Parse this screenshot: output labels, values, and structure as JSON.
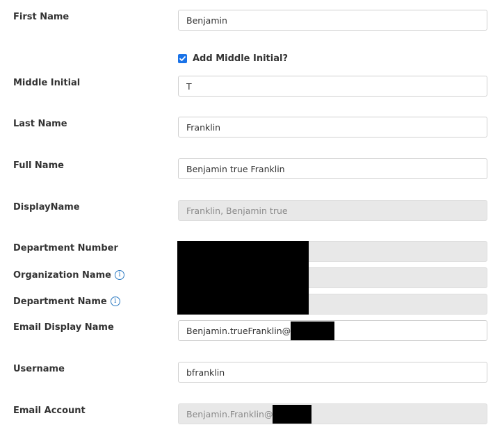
{
  "fields": {
    "first_name": {
      "label": "First Name",
      "value": "Benjamin"
    },
    "add_middle_initial": {
      "label": "Add Middle Initial?",
      "checked": true
    },
    "middle_initial": {
      "label": "Middle Initial",
      "value": "T"
    },
    "last_name": {
      "label": "Last Name",
      "value": "Franklin"
    },
    "full_name": {
      "label": "Full Name",
      "value": "Benjamin true Franklin"
    },
    "display_name": {
      "label": "DisplayName",
      "value": "Franklin, Benjamin true"
    },
    "department_number": {
      "label": "Department Number",
      "value": ""
    },
    "organization_name": {
      "label": "Organization Name",
      "value": "",
      "info_icon": "info-icon"
    },
    "department_name": {
      "label": "Department Name",
      "value": "",
      "info_icon": "info-icon"
    },
    "email_display_name": {
      "label": "Email Display Name",
      "value": "Benjamin.trueFranklin@"
    },
    "username": {
      "label": "Username",
      "value": "bfranklin"
    },
    "email_account": {
      "label": "Email Account",
      "value": "Benjamin.Franklin@"
    }
  },
  "colors": {
    "accent": "#1a73e8",
    "info": "#2b79c2",
    "readonly_bg": "#e8e8e8",
    "redaction": "#000000"
  }
}
